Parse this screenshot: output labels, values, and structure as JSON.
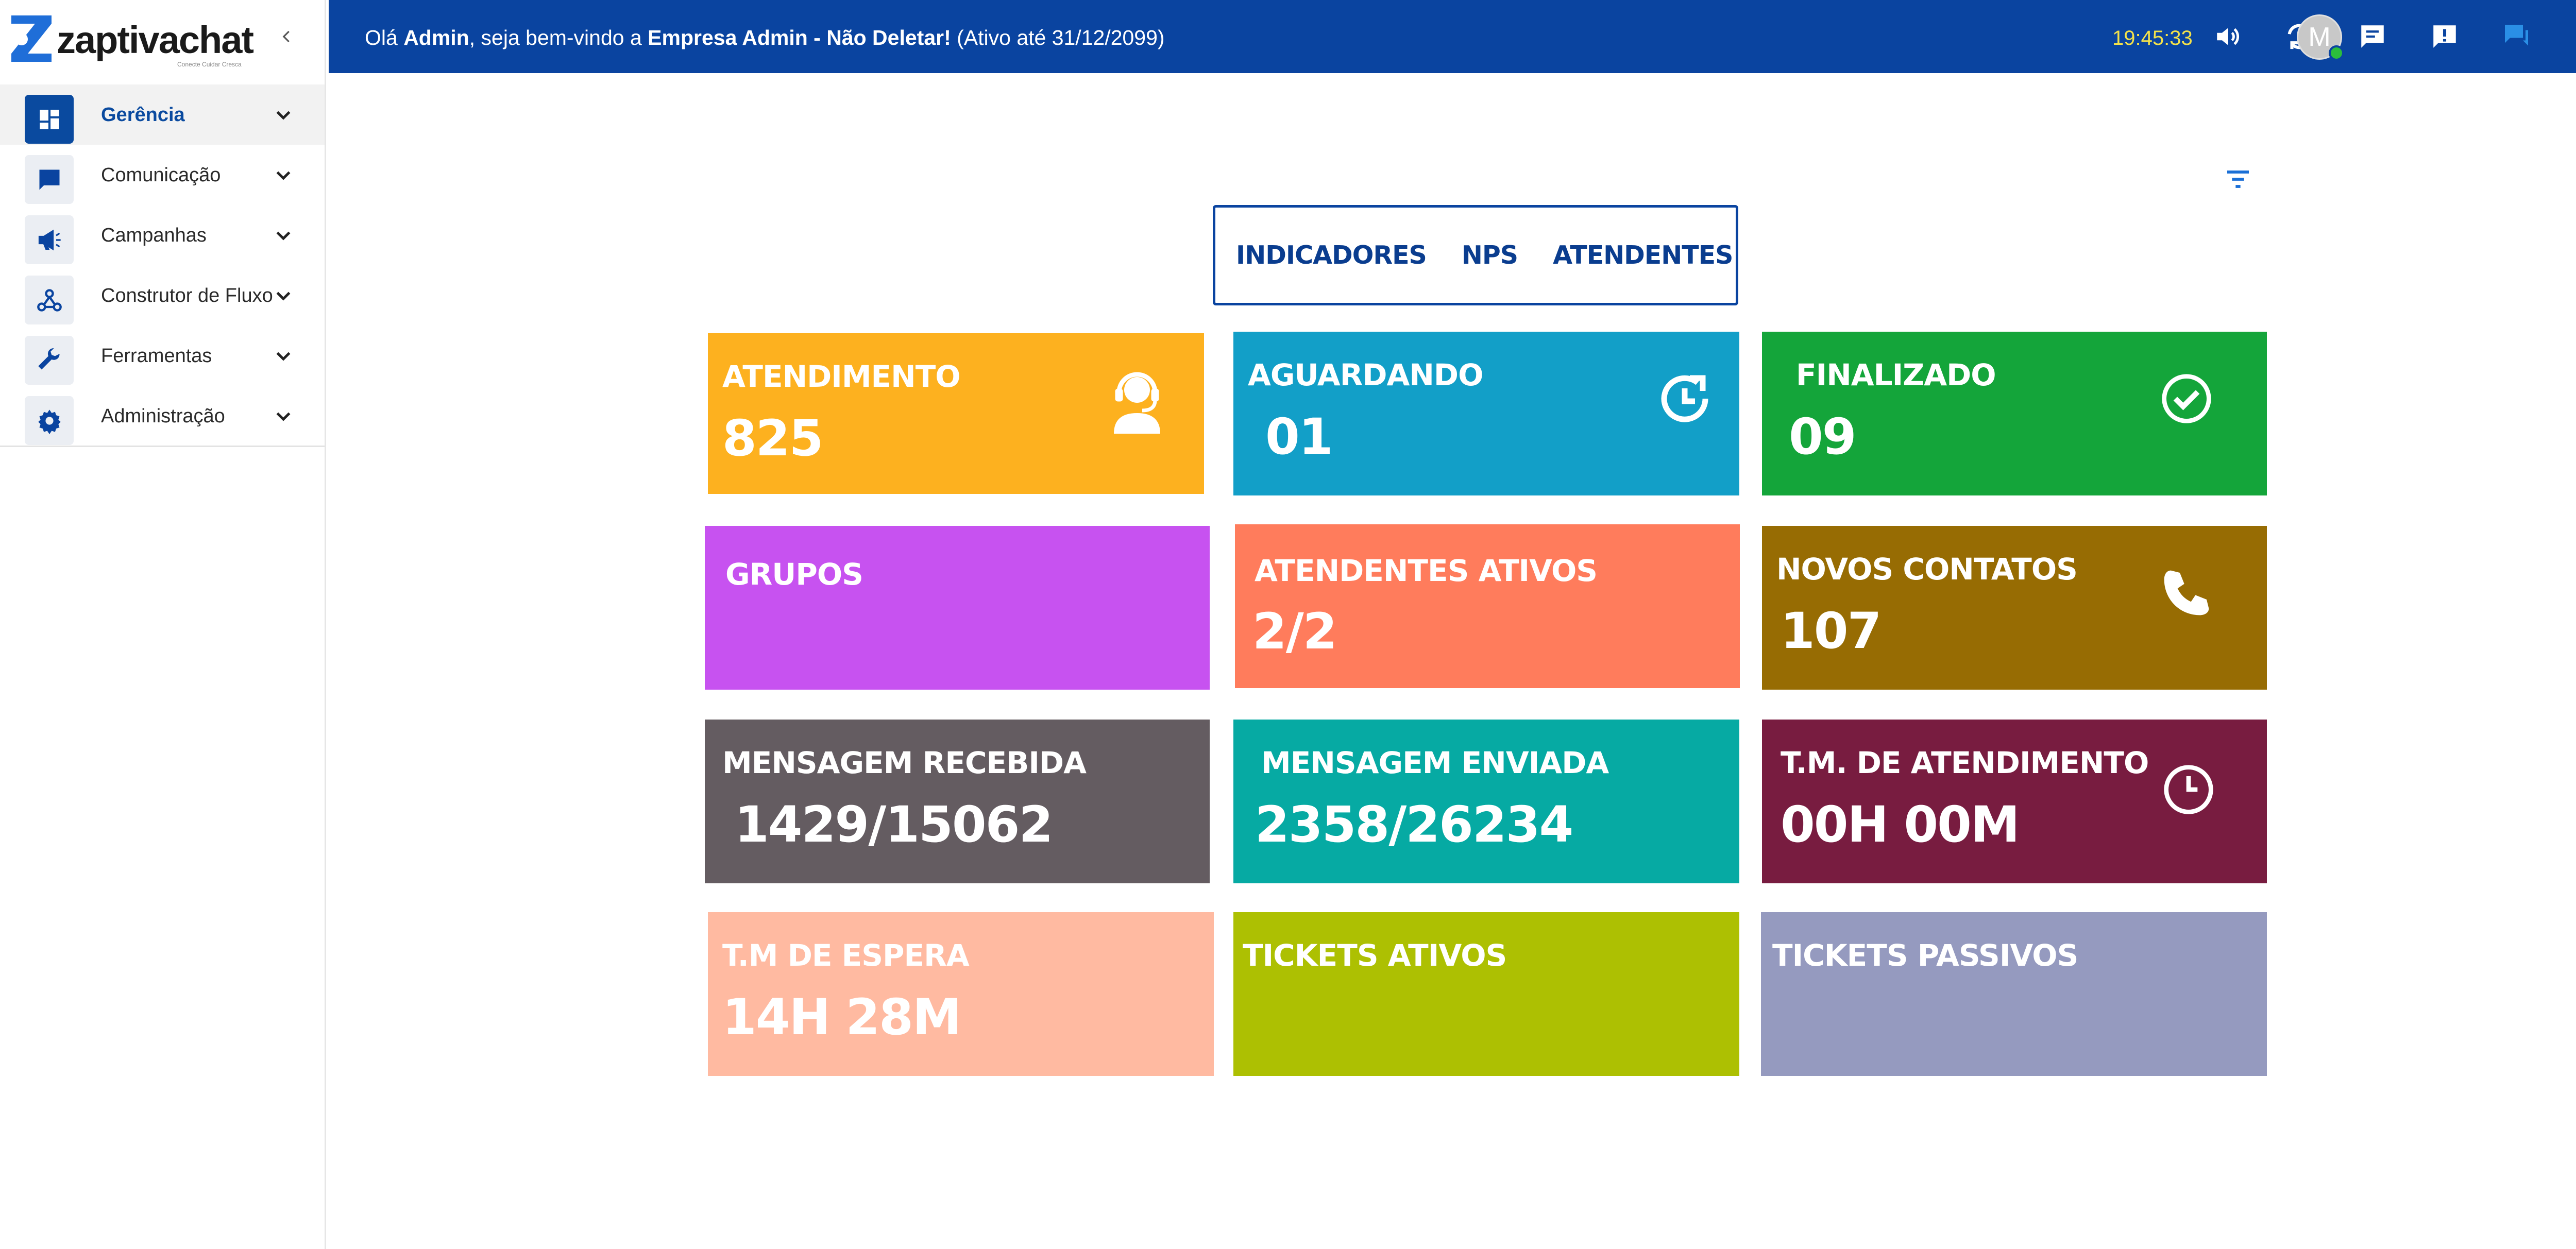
{
  "sidebar": {
    "logo": {
      "brand": "zaptivachat",
      "tagline": "Conecte Cuidar Cresca"
    },
    "items": [
      {
        "label": "Gerência",
        "icon": "dashboard-icon",
        "active": true
      },
      {
        "label": "Comunicação",
        "icon": "chat-icon"
      },
      {
        "label": "Campanhas",
        "icon": "megaphone-icon"
      },
      {
        "label": "Construtor de Fluxo",
        "icon": "webhook-icon"
      },
      {
        "label": "Ferramentas",
        "icon": "wrench-icon"
      },
      {
        "label": "Administração",
        "icon": "gear-icon"
      }
    ]
  },
  "header": {
    "greeting_prefix": "Olá ",
    "user": "Admin",
    "greeting_middle": ", seja bem-vindo a ",
    "company": "Empresa Admin - Não Deletar!",
    "validity": " (Ativo até 31/12/2099)",
    "clock": "19:45:33",
    "avatar_letter": "M",
    "icons": [
      "volume-icon",
      "refresh-icon",
      "message-icon",
      "alert-icon",
      "chats-icon"
    ]
  },
  "tabs": [
    "INDICADORES",
    "NPS",
    "ATENDENTES"
  ],
  "cards": [
    {
      "title": "ATENDIMENTO",
      "value": "825",
      "color": "#fdb11f",
      "icon": "headset-user-icon"
    },
    {
      "title": "AGUARDANDO",
      "value": "01",
      "color": "#129fc8",
      "icon": "clock-refresh-icon"
    },
    {
      "title": "FINALIZADO",
      "value": "09",
      "color": "#14a53a",
      "icon": "check-circle-icon"
    },
    {
      "title": "GRUPOS",
      "value": "",
      "color": "#c752f0"
    },
    {
      "title": "ATENDENTES ATIVOS",
      "value": "2/2",
      "color": "#ff7c5c"
    },
    {
      "title": "NOVOS CONTATOS",
      "value": "107",
      "color": "#976c03",
      "icon": "phone-icon"
    },
    {
      "title": "MENSAGEM RECEBIDA",
      "value": "1429/15062",
      "color": "#645c61"
    },
    {
      "title": "MENSAGEM ENVIADA",
      "value": "2358/26234",
      "color": "#06aaa3"
    },
    {
      "title": "T.M. DE ATENDIMENTO",
      "value": "00H 00M",
      "color": "#781c40",
      "icon": "clock-icon"
    },
    {
      "title": "T.M DE ESPERA",
      "value": "14H 28M",
      "color": "#ffbaa1"
    },
    {
      "title": "TICKETS ATIVOS",
      "value": "",
      "color": "#adc002"
    },
    {
      "title": "TICKETS PASSIVOS",
      "value": "",
      "color": "#959abf"
    }
  ]
}
